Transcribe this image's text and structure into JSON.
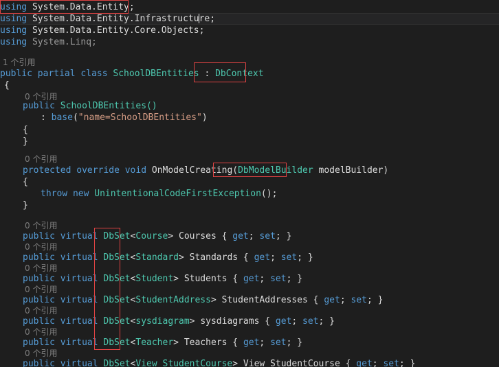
{
  "editor": {
    "background": "#1e1e1e",
    "foreground": "#dcdcdc",
    "keyword_color": "#569cd6",
    "type_color": "#4ec9b0",
    "string_color": "#d69d85",
    "codelens_color": "#7d7d7d",
    "annotation_color": "#e04343"
  },
  "codelens": {
    "class_ref": "1 个引用",
    "zero_ref": "0 个引用"
  },
  "lines": {
    "using1": {
      "kw": "using",
      "ns": " System.Data.Entity;"
    },
    "using2": {
      "kw": "using",
      "ns": " System.Data.Entity.Infrastructure;"
    },
    "using3": {
      "kw": "using",
      "ns": " System.Data.Entity.Core.Objects;"
    },
    "using4": {
      "kw": "using",
      "ns": " System.Linq;"
    },
    "class_decl": {
      "mod1": "public",
      "mod2": "partial",
      "mod3": "class",
      "name": "SchoolDBEntities",
      "colon": " : ",
      "base": "DbContext"
    },
    "open_brace": "{",
    "close_brace": "}",
    "ctor": {
      "mod": "public",
      "name": " SchoolDBEntities()"
    },
    "ctor_base": {
      "colon": ": ",
      "base": "base",
      "open": "(",
      "str": "\"name=SchoolDBEntities\"",
      "close": ")"
    },
    "onmodel": {
      "mod1": "protected",
      "mod2": "override",
      "mod3": "void",
      "name": " OnModelCreating(",
      "param_type": "DbModelBuilder",
      "param_name": " modelBuilder)"
    },
    "throw_line": {
      "kw1": "throw",
      "kw2": "new",
      "type": "UnintentionalCodeFirstException",
      "tail": "();"
    }
  },
  "dbsets": [
    {
      "mods": "public virtual ",
      "dbset": "DbSet",
      "lt": "<",
      "generic": "Course",
      "gt": "> ",
      "prop": "Courses",
      "accessors": " { get; set; }"
    },
    {
      "mods": "public virtual ",
      "dbset": "DbSet",
      "lt": "<",
      "generic": "Standard",
      "gt": "> ",
      "prop": "Standards",
      "accessors": " { get; set; }"
    },
    {
      "mods": "public virtual ",
      "dbset": "DbSet",
      "lt": "<",
      "generic": "Student",
      "gt": "> ",
      "prop": "Students",
      "accessors": " { get; set; }"
    },
    {
      "mods": "public virtual ",
      "dbset": "DbSet",
      "lt": "<",
      "generic": "StudentAddress",
      "gt": "> ",
      "prop": "StudentAddresses",
      "accessors": " { get; set; }"
    },
    {
      "mods": "public virtual ",
      "dbset": "DbSet",
      "lt": "<",
      "generic": "sysdiagram",
      "gt": "> ",
      "prop": "sysdiagrams",
      "accessors": " { get; set; }"
    },
    {
      "mods": "public virtual ",
      "dbset": "DbSet",
      "lt": "<",
      "generic": "Teacher",
      "gt": "> ",
      "prop": "Teachers",
      "accessors": " { get; set; }"
    },
    {
      "mods": "public virtual ",
      "dbset": "DbSet",
      "lt": "<",
      "generic": "View_StudentCourse",
      "gt": "> ",
      "prop": "View_StudentCourse",
      "accessors": " { get; set; }"
    }
  ],
  "accessor_tokens": {
    "open": " { ",
    "get": "get",
    "semi1": "; ",
    "set": "set",
    "semi2": "; ",
    "close": "}"
  },
  "annotations": [
    {
      "name": "using-entity-highlight-box"
    },
    {
      "name": "dbcontext-highlight-box"
    },
    {
      "name": "dbmodelbuilder-highlight-box"
    },
    {
      "name": "dbset-column-highlight-box"
    }
  ]
}
